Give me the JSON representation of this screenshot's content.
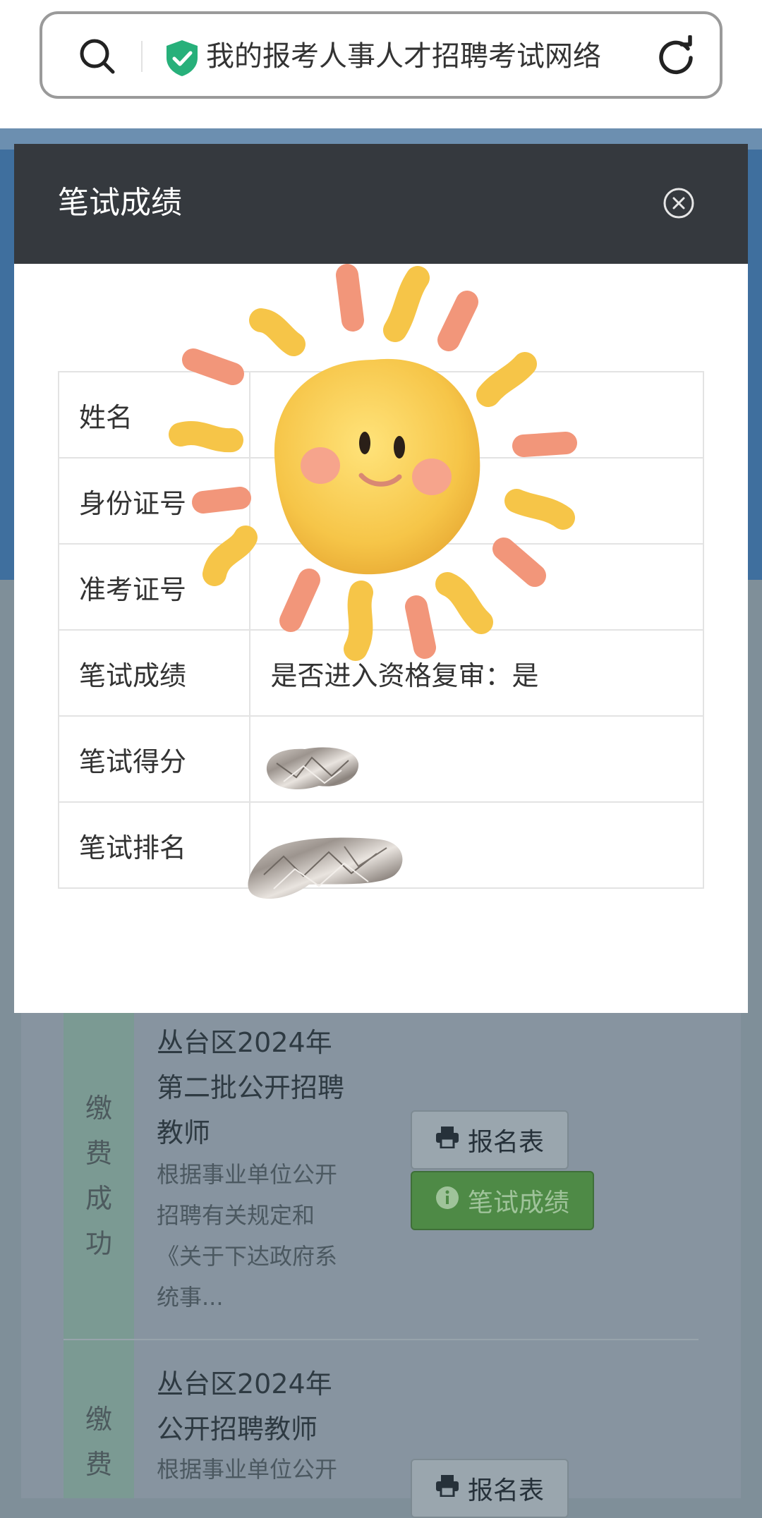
{
  "browser": {
    "url_title": "我的报考人事人才招聘考试网络",
    "icons": {
      "search": "search-icon",
      "secure": "shield-check-icon",
      "reload": "reload-icon"
    }
  },
  "modal": {
    "title": "笔试成绩",
    "close_icon": "close-circle-icon",
    "rows": [
      {
        "label": "姓名",
        "value": ""
      },
      {
        "label": "身份证号",
        "value": ""
      },
      {
        "label": "准考证号",
        "value": ""
      },
      {
        "label": "笔试成绩",
        "value": "是否进入资格复审：是"
      },
      {
        "label": "笔试得分",
        "value": ""
      },
      {
        "label": "笔试排名",
        "value": ""
      }
    ]
  },
  "list": {
    "items": [
      {
        "status_chars": [
          "缴",
          "费",
          "成",
          "功"
        ],
        "title_lines": [
          "丛台区2024年",
          "第二批公开招聘",
          "教师"
        ],
        "desc_lines": [
          "根据事业单位公开",
          "招聘有关规定和",
          "《关于下达政府系",
          "统事..."
        ],
        "form_button": "报名表",
        "score_button": "笔试成绩"
      },
      {
        "status_chars": [
          "缴",
          "费"
        ],
        "title_lines": [
          "丛台区2024年",
          "公开招聘教师"
        ],
        "desc_lines": [
          "根据事业单位公开"
        ],
        "form_button": "报名表"
      }
    ]
  },
  "colors": {
    "modal_header": "#35393e",
    "score_button": "#4e8a46",
    "status_column": "#7b9a93",
    "banner": "#3f6f9e"
  }
}
